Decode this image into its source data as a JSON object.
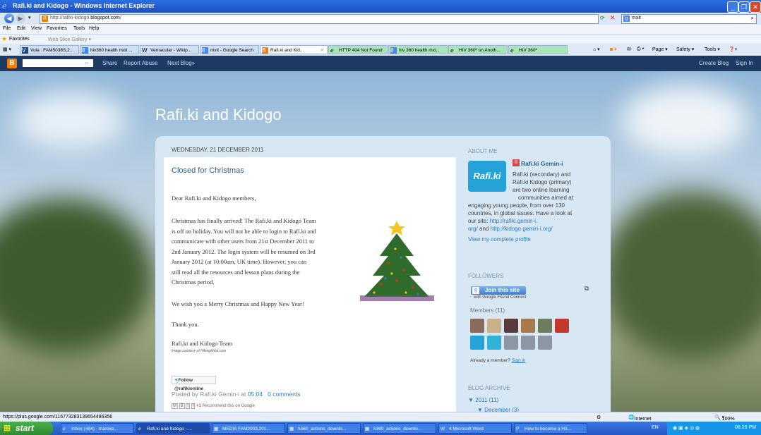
{
  "window": {
    "title": "Rafi.ki and Kidogo - Windows Internet Explorer"
  },
  "address": {
    "url_prefix": "http://rafiki-kidogo.",
    "url_domain": "blogspot.com",
    "url_suffix": "/",
    "search_value": "mxit"
  },
  "menu": [
    "File",
    "Edit",
    "View",
    "Favorites",
    "Tools",
    "Help"
  ],
  "favorites": {
    "label": "Favorites",
    "webslice": "Web Slice Gallery ▾"
  },
  "tabs": [
    {
      "label": "Vula : FAM5038S,2..."
    },
    {
      "label": "hiv360 health mxit ..."
    },
    {
      "label": "Vernacular - Wikip..."
    },
    {
      "label": "mxit - Google Search"
    },
    {
      "label": "Rafi.ki and Kid..."
    },
    {
      "label": "HTTP 404 Not Found"
    },
    {
      "label": "hiv 360 health mxi..."
    },
    {
      "label": "HIV 360º on Anoth..."
    },
    {
      "label": "HIV 360º"
    }
  ],
  "toolbar_right": {
    "page": "Page ▾",
    "safety": "Safety ▾",
    "tools": "Tools ▾"
  },
  "blognav": {
    "share": "Share",
    "report": "Report Abuse",
    "next": "Next Blog»",
    "create": "Create Blog",
    "signin": "Sign In"
  },
  "blog": {
    "title": "Rafi.ki and Kidogo"
  },
  "post": {
    "date": "WEDNESDAY, 21 DECEMBER 2011",
    "title": "Closed for Christmas",
    "greeting": "Dear Rafi.ki and Kidogo members,",
    "para1_lines": [
      "Christmas has finally arrived! The Rafi.ki and Kidogo Team",
      "is off on holiday. You will not be able to login to Rafi.ki and",
      "communicate with other users from 21st December 2011 to",
      "2nd January 2012. The login system will be resumed on 3rd",
      "January 2012 (at 10:00am, UK time). However, you can",
      "still read all the resources and lesson plans during the",
      "Christmas period."
    ],
    "wish": "We wish you a Merry Christmas and Happy New Year!",
    "thanks": "Thank you.",
    "signoff": "Rafi.ki and Kidogo Team",
    "image_credit": "Image courtesy of HikingArtist.com",
    "follow_label": "Follow @rafikionline",
    "footer_prefix": "Posted by Rafi.ki Gemin-i at",
    "footer_time": "05:04",
    "footer_comments": "0 comments",
    "share_text": "Recommend this on Google"
  },
  "sidebar": {
    "about_header": "ABOUT ME",
    "avatar_text": "Rafi.ki",
    "profile_name": "Rafi.ki Gemin-i",
    "about_lines": [
      "Rafi.ki (secondary) and",
      "Rafi.ki Kidogo (primary)",
      "are two online learning",
      "communities aimed at",
      "engaging young people, from over 130",
      "countries, in global issues. Have a look at",
      "our site:"
    ],
    "link1": "http://rafiki.gemin-i.",
    "link1b": "org/",
    "and_text": "and",
    "link2": "http://kidogo.gemin-i.org/",
    "view_profile": "View my complete profile",
    "followers_header": "FOLLOWERS",
    "join": "Join this site",
    "gfc": "with Google Friend Connect",
    "members": "Members (11)",
    "already": "Already a member?",
    "signin": "Sign in",
    "archive_header": "BLOG ARCHIVE",
    "archive_year": "▼ 2011 (11)",
    "archive_month": "▼ December (3)"
  },
  "status": {
    "url": "https://plus.google.com/116773283139654486356",
    "zone": "Internet",
    "zoom": "100%"
  },
  "taskbar": {
    "start": "start",
    "tasks": [
      "Inbox (484) - mareke...",
      "Rafi.ki and Kidogo - ...",
      "MEDIA FAM2003,201...",
      "h360_actions_downlo...",
      "h360_actions_downlo...",
      "4 Microsoft Word",
      "How to become a H3..."
    ],
    "lang": "EN",
    "clock": "06:29 PM"
  }
}
